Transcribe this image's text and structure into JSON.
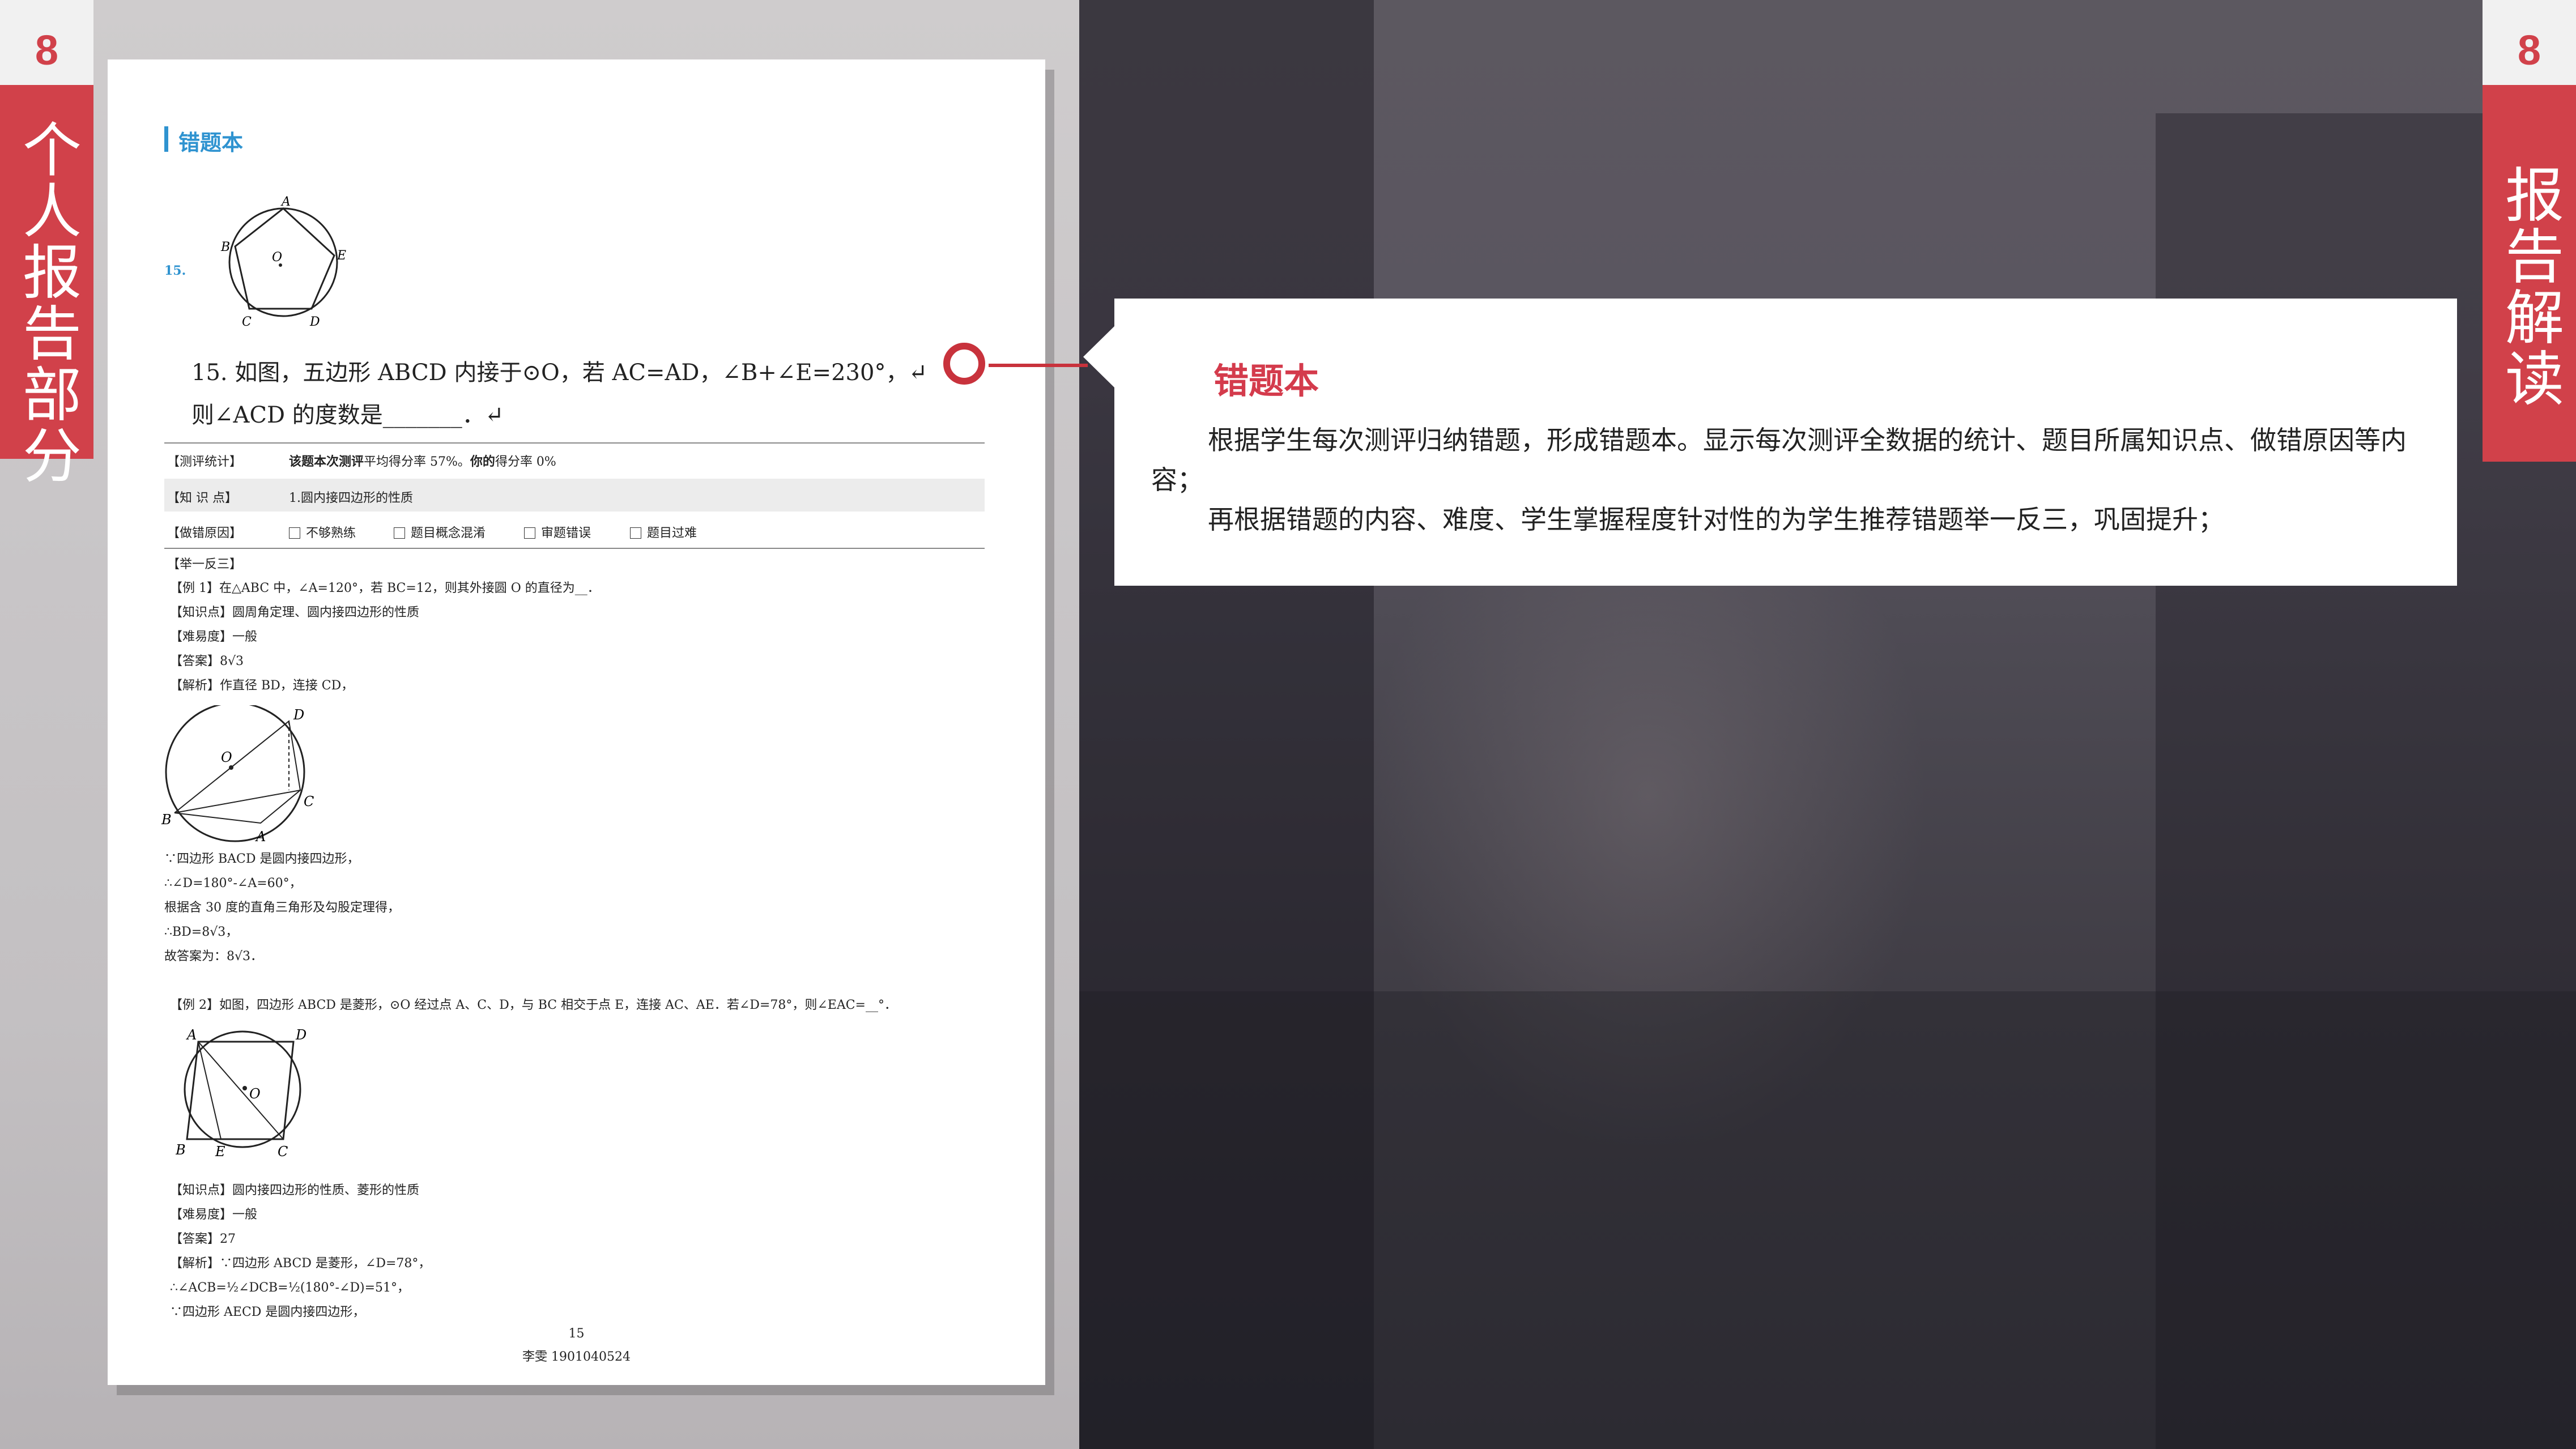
{
  "left_tab": {
    "number": "8",
    "title": "个人报告部分"
  },
  "right_tab": {
    "number": "8",
    "title": "报告解读"
  },
  "document": {
    "header": "错题本",
    "question_number": "15.",
    "question_line1": "15. 如图，五边形 ABCD 内接于⊙O，若 AC=AD，∠B+∠E=230°，↵",
    "question_line2": "则∠ACD 的度数是_______．↵",
    "stats_label": "【测评统计】",
    "stats_text_bold1": "该题本次测评",
    "stats_text1": "平均得分率 57%。",
    "stats_text_bold2": "你的",
    "stats_text2": "得分率 0%",
    "knowledge_label": "【知 识 点】",
    "knowledge_value": "1.圆内接四边形的性质",
    "error_label": "【做错原因】",
    "error_reasons": [
      "不够熟练",
      "题目概念混淆",
      "审题错误",
      "题目过难"
    ],
    "practice_title": "【举一反三】",
    "example1": {
      "stem": "【例 1】在△ABC 中，∠A=120°，若 BC=12，则其外接圆 O 的直径为__．",
      "knowledge": "【知识点】圆周角定理、圆内接四边形的性质",
      "difficulty": "【难易度】一般",
      "answer": "【答案】8√3",
      "analysis": "【解析】作直径 BD，连接 CD，",
      "steps": [
        "∵四边形 BACD 是圆内接四边形，",
        "∴∠D=180°-∠A=60°，",
        "根据含 30 度的直角三角形及勾股定理得，",
        "∴BD=8√3，",
        "故答案为：8√3．"
      ]
    },
    "example2": {
      "stem": "【例 2】如图，四边形 ABCD 是菱形，⊙O 经过点 A、C、D，与 BC 相交于点 E，连接 AC、AE．若∠D=78°，则∠EAC=__°．",
      "knowledge": "【知识点】圆内接四边形的性质、菱形的性质",
      "difficulty": "【难易度】一般",
      "answer": "【答案】27",
      "analysis": "【解析】∵四边形 ABCD 是菱形，∠D=78°，",
      "steps": [
        "∴∠ACB=½∠DCB=½(180°-∠D)=51°，",
        "∵四边形 AECD 是圆内接四边形，"
      ]
    },
    "page_number": "15",
    "student": "李雯 1901040524"
  },
  "figure_labels": {
    "pentagon": [
      "A",
      "B",
      "E",
      "C",
      "D",
      "O"
    ],
    "circle1": [
      "D",
      "O",
      "B",
      "C",
      "A"
    ],
    "circle2": [
      "A",
      "D",
      "O",
      "B",
      "E",
      "C"
    ]
  },
  "card": {
    "title": "错题本",
    "paragraph1": "根据学生每次测评归纳错题，形成错题本。显示每次测评全数据的统计、题目所属知识点、做错原因等内容；",
    "paragraph2": "再根据错题的内容、难度、学生掌握程度针对性的为学生推荐错题举一反三，巩固提升；"
  },
  "colors": {
    "accent_red": "#d1414a",
    "doc_blue": "#2f93d0",
    "card_title_red": "#d43b4c"
  }
}
